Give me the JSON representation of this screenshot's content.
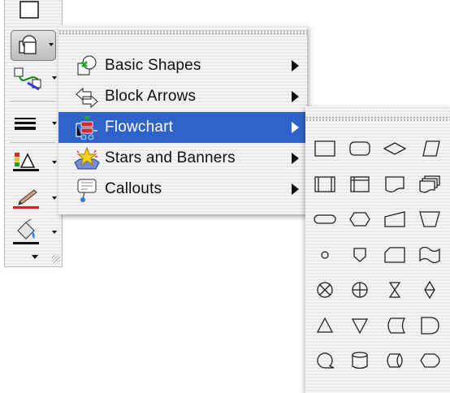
{
  "menu": {
    "items": [
      {
        "label": "Basic Shapes",
        "icon": "basic-shapes-icon",
        "selected": false
      },
      {
        "label": "Block Arrows",
        "icon": "block-arrows-icon",
        "selected": false
      },
      {
        "label": "Flowchart",
        "icon": "flowchart-icon",
        "selected": true
      },
      {
        "label": "Stars and Banners",
        "icon": "stars-and-banners-icon",
        "selected": false
      },
      {
        "label": "Callouts",
        "icon": "callouts-icon",
        "selected": false
      }
    ],
    "selected_color": "#2f63c9"
  },
  "toolbar": {
    "buttons": [
      "rectangle-icon",
      "autoshapes-icon",
      "connector-icon",
      "line-style-icon",
      "fill-color-icon",
      "line-color-icon",
      "paint-bucket-icon"
    ]
  },
  "flowchart_shapes": [
    [
      "process",
      "alternate-process",
      "decision",
      "data"
    ],
    [
      "predefined-process",
      "internal-storage",
      "document",
      "multidocument"
    ],
    [
      "terminator",
      "preparation",
      "manual-input",
      "manual-operation"
    ],
    [
      "connector",
      "off-page-connector",
      "card",
      "punched-tape"
    ],
    [
      "summing-junction",
      "or",
      "collate",
      "sort"
    ],
    [
      "extract",
      "merge",
      "stored-data",
      "delay"
    ],
    [
      "sequential-access-storage",
      "magnetic-disk",
      "direct-access-storage",
      "display"
    ]
  ]
}
